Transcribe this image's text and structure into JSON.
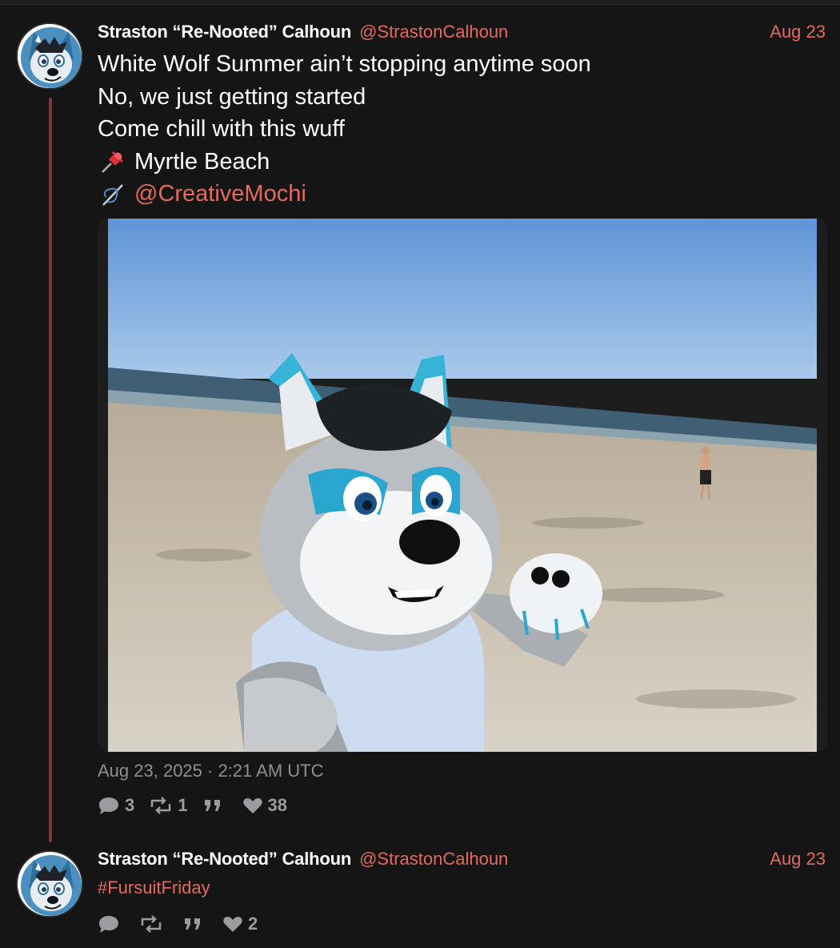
{
  "posts": [
    {
      "author_name": "Straston “Re-Nooted” Calhoun",
      "handle": "@StrastonCalhoun",
      "date": "Aug 23",
      "lines": [
        "White Wolf Summer ain’t stopping anytime soon",
        "No, we just getting started",
        "Come chill with this wuff",
        "Myrtle Beach",
        "@CreativeMochi"
      ],
      "line_icons": [
        "",
        "",
        "",
        "pushpin-icon",
        "sewing-needle-icon"
      ],
      "media_alt": "beach-fursuit-photo",
      "timestamp": "Aug 23, 2025 · 2:21 AM UTC",
      "stats": {
        "replies": "3",
        "reposts": "1",
        "quotes": "",
        "likes": "38"
      }
    },
    {
      "author_name": "Straston “Re-Nooted” Calhoun",
      "handle": "@StrastonCalhoun",
      "date": "Aug 23",
      "hashtag": "#FursuitFriday",
      "stats": {
        "replies": "",
        "reposts": "",
        "quotes": "",
        "likes": "2"
      }
    }
  ],
  "colors": {
    "background": "#151516",
    "accent": "#e36a5d",
    "thread_line": "#7a3a3a",
    "muted": "#9c9ca0"
  }
}
